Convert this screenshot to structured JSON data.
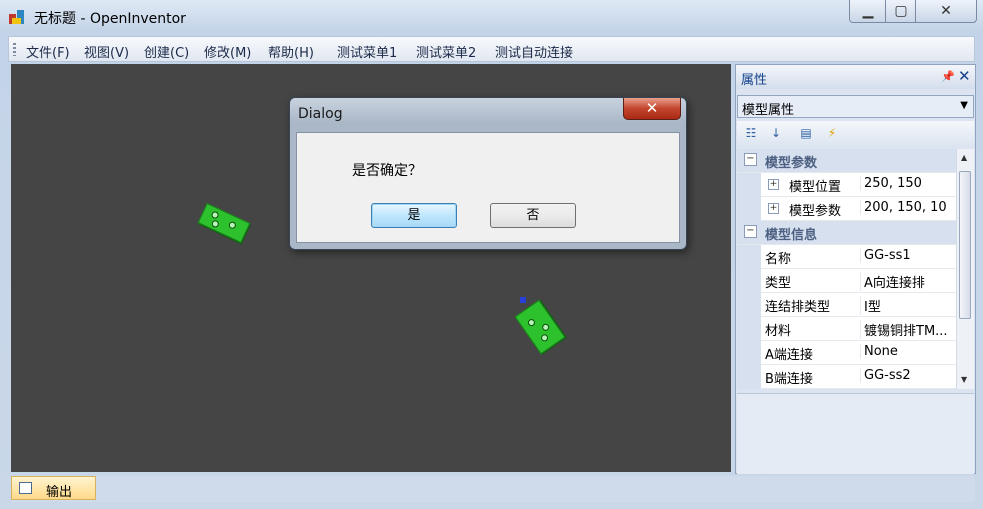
{
  "window": {
    "title": "无标题 - OpenInventor",
    "app_icon": "app-icon"
  },
  "window_buttons": {
    "minimize": "minimize-icon",
    "maximize": "maximize-icon",
    "close": "close-icon"
  },
  "menu": [
    "文件(F)",
    "视图(V)",
    "创建(C)",
    "修改(M)",
    "帮助(H)",
    "测试菜单1",
    "测试菜单2",
    "测试自动连接"
  ],
  "properties": {
    "title": "属性",
    "combo": "模型属性",
    "categories": [
      {
        "name": "模型参数",
        "rows": [
          {
            "name": "模型位置",
            "value": "250, 150",
            "expandable": true
          },
          {
            "name": "模型参数",
            "value": "200, 150, 10",
            "expandable": true
          }
        ]
      },
      {
        "name": "模型信息",
        "rows": [
          {
            "name": "名称",
            "value": "GG-ss1"
          },
          {
            "name": "类型",
            "value": "A向连接排"
          },
          {
            "name": "连结排类型",
            "value": "I型"
          },
          {
            "name": "材料",
            "value": "镀锡铜排TM..."
          },
          {
            "name": "A端连接",
            "value": "None"
          },
          {
            "name": "B端连接",
            "value": "GG-ss2"
          }
        ]
      }
    ]
  },
  "output_tab": "输出",
  "dialog": {
    "title": "Dialog",
    "message": "是否确定？",
    "yes": "是",
    "no": "否"
  },
  "colors": {
    "viewport": "#454545",
    "part": "#2ec12e",
    "accent": "#15428b"
  }
}
